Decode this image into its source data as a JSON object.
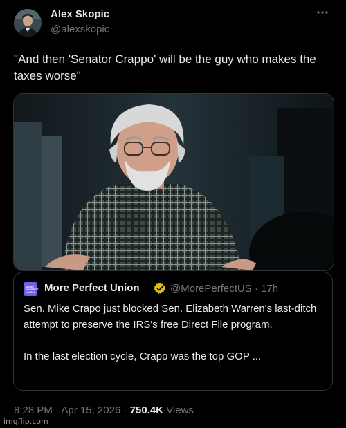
{
  "author": {
    "name": "Alex Skopic",
    "handle": "@alexskopic"
  },
  "more_icon": "more-horizontal-icon",
  "tweet_text": "\"And then 'Senator Crappo' will be the guy who makes the taxes worse\"",
  "media": {
    "kind": "video-still"
  },
  "quoted": {
    "logo_text": "MORE PERFECT UNION",
    "name": "More Perfect Union",
    "verified_icon": "verified-badge-icon",
    "verified_color": "#e2b719",
    "handle": "@MorePerfectUS",
    "separator": "·",
    "time": "17h",
    "text": "Sen. Mike Crapo just blocked Sen. Elizabeth Warren's last-ditch attempt to preserve the IRS's free Direct File program.\n\nIn the last election cycle, Crapo was the top GOP ..."
  },
  "meta": {
    "time": "8:28 PM",
    "date": "Apr 15, 2026",
    "separator": "·",
    "views_count": "750.4K",
    "views_label": "Views"
  },
  "watermark": "imgflip.com",
  "colors": {
    "background": "#000000",
    "text_primary": "#e7e9ea",
    "text_secondary": "#71767b",
    "border": "#2f3336"
  }
}
